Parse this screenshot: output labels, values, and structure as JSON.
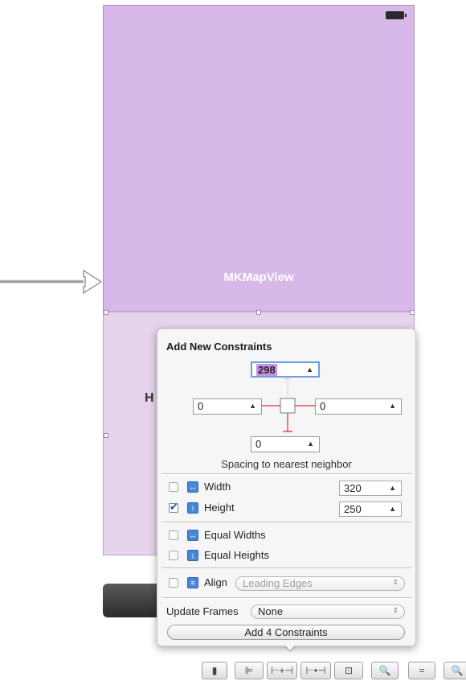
{
  "canvas": {
    "map_view_label": "MKMapView",
    "partial_label": "H"
  },
  "popover": {
    "title": "Add New Constraints",
    "top_value": "298",
    "left_value": "0",
    "right_value": "0",
    "bottom_value": "0",
    "spacing_label": "Spacing to nearest neighbor",
    "width_label": "Width",
    "width_value": "320",
    "width_checked": false,
    "height_label": "Height",
    "height_value": "250",
    "height_checked": true,
    "equal_widths_label": "Equal Widths",
    "equal_heights_label": "Equal Heights",
    "align_label": "Align",
    "align_value": "Leading Edges",
    "update_frames_label": "Update Frames",
    "update_frames_value": "None",
    "add_button_label": "Add 4 Constraints"
  },
  "icons": {
    "stepper": "▲",
    "updown": "⇕",
    "battery": "battery-icon",
    "arrow": "entry-point-arrow-icon"
  },
  "colors": {
    "map_view": "#d8b8e8",
    "accent_blue": "#4a86d8",
    "constraint_red": "#d9534f"
  },
  "toolbar": {
    "buttons": [
      "document-outline-icon",
      "align-icon",
      "pin-icon",
      "resolve-icon",
      "resizing-icon",
      "zoom-out-icon",
      "zoom-actual-icon",
      "zoom-in-icon"
    ]
  }
}
